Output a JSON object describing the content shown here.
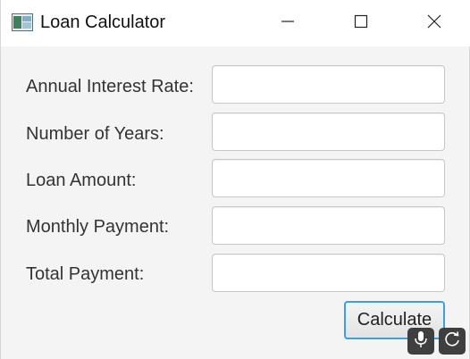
{
  "window": {
    "title": "Loan Calculator",
    "icon": "app-window-icon",
    "controls": {
      "minimize": "minimize-icon",
      "maximize": "maximize-icon",
      "close": "close-icon"
    }
  },
  "form": {
    "fields": [
      {
        "label": "Annual Interest Rate:",
        "value": ""
      },
      {
        "label": "Number of Years:",
        "value": ""
      },
      {
        "label": "Loan Amount:",
        "value": ""
      },
      {
        "label": "Monthly Payment:",
        "value": ""
      },
      {
        "label": "Total Payment:",
        "value": ""
      }
    ],
    "calculate_label": "Calculate"
  },
  "overlay": {
    "mic_icon": "microphone-icon",
    "refresh_icon": "refresh-icon"
  },
  "colors": {
    "focus_accent": "#3e9ee0",
    "titlebar": "#ffffff",
    "background": "#f4f4f4"
  }
}
